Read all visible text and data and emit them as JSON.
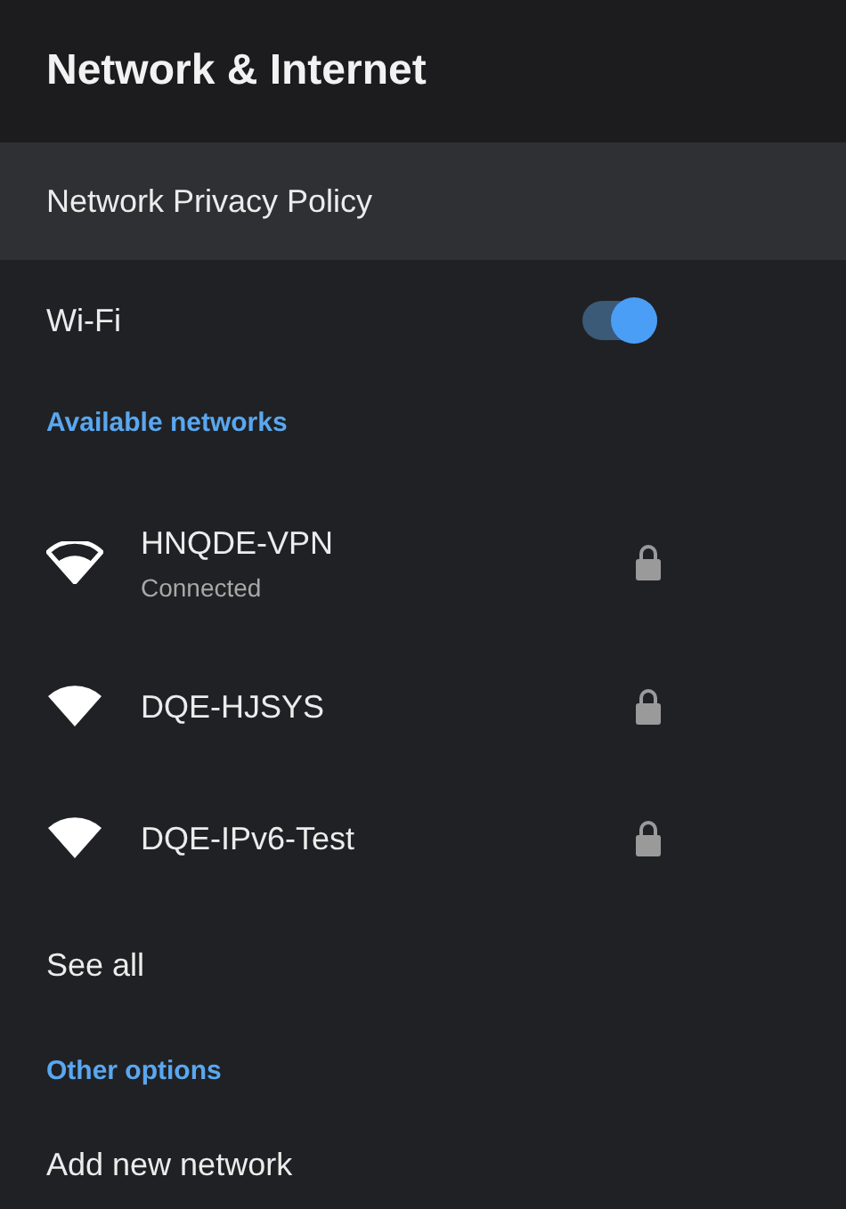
{
  "header": {
    "title": "Network & Internet"
  },
  "items": [
    {
      "kind": "link",
      "label": "Network Privacy Policy",
      "selected": true
    },
    {
      "kind": "toggle",
      "label": "Wi-Fi",
      "on": true,
      "selected": false
    },
    {
      "kind": "section",
      "label": "Available networks"
    },
    {
      "kind": "network",
      "label": "HNQDE-VPN",
      "status": "Connected",
      "connected": true,
      "secured": true,
      "selected": false
    },
    {
      "kind": "network",
      "label": "DQE-HJSYS",
      "connected": false,
      "secured": true,
      "selected": false
    },
    {
      "kind": "network",
      "label": "DQE-IPv6-Test",
      "connected": false,
      "secured": true,
      "selected": false
    },
    {
      "kind": "link",
      "label": "See all",
      "selected": false
    },
    {
      "kind": "section",
      "label": "Other options"
    },
    {
      "kind": "link",
      "label": "Add new network",
      "selected": false
    }
  ]
}
